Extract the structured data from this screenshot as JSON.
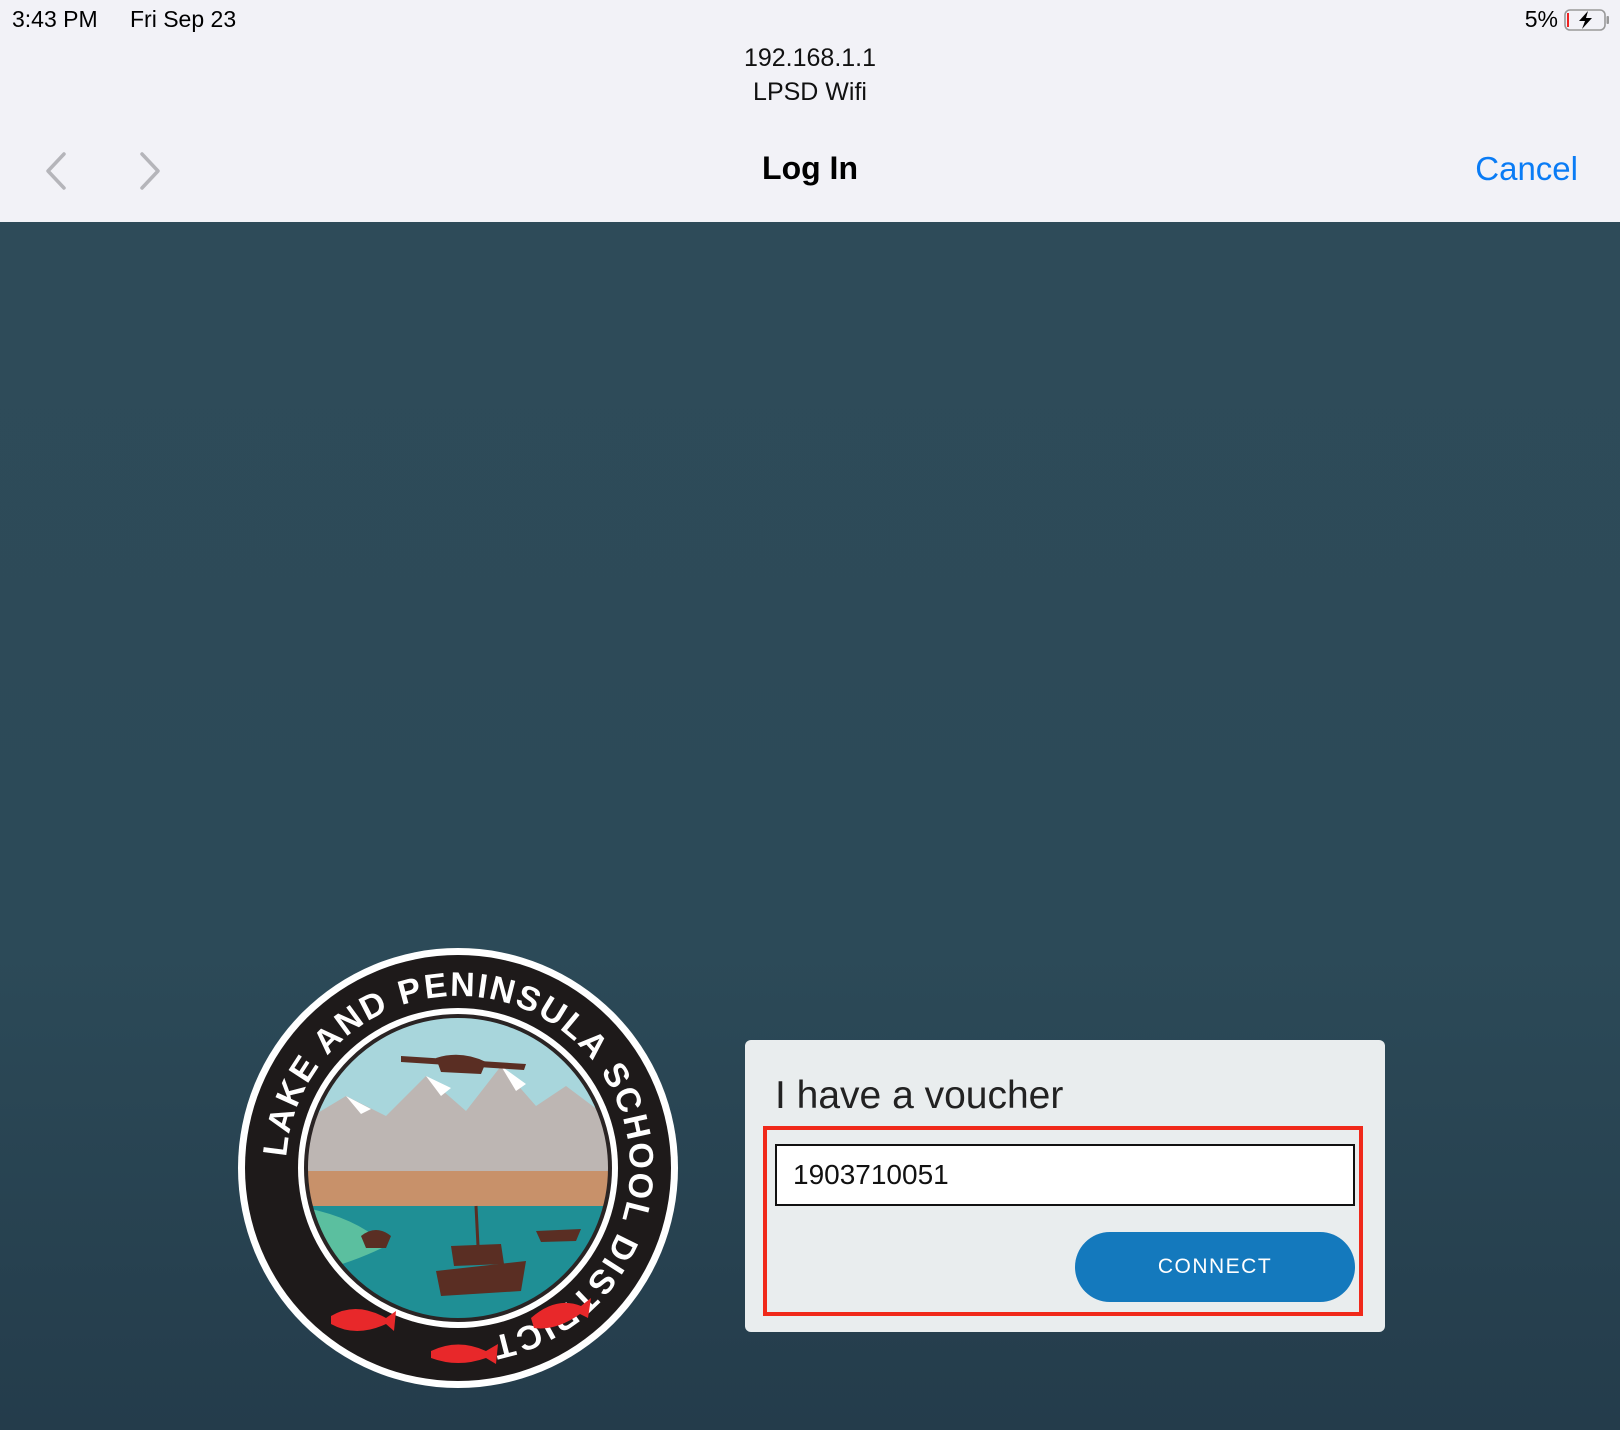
{
  "status_bar": {
    "time": "3:43 PM",
    "date": "Fri Sep 23",
    "battery_percent": "5%",
    "battery_icon": "battery-charging-icon"
  },
  "header": {
    "host": "192.168.1.1",
    "network_name": "LPSD Wifi",
    "title": "Log In",
    "cancel_label": "Cancel",
    "back_icon": "chevron-left-icon",
    "forward_icon": "chevron-right-icon"
  },
  "logo": {
    "ring_text": "LAKE AND PENINSULA SCHOOL DISTRICT"
  },
  "voucher_card": {
    "title": "I have a voucher",
    "voucher_value": "1903710051",
    "connect_label": "CONNECT"
  },
  "colors": {
    "accent_link": "#0a7cf5",
    "portal_background": "#2c4a58",
    "connect_button": "#1479bd",
    "highlight_box": "#f0291a"
  }
}
